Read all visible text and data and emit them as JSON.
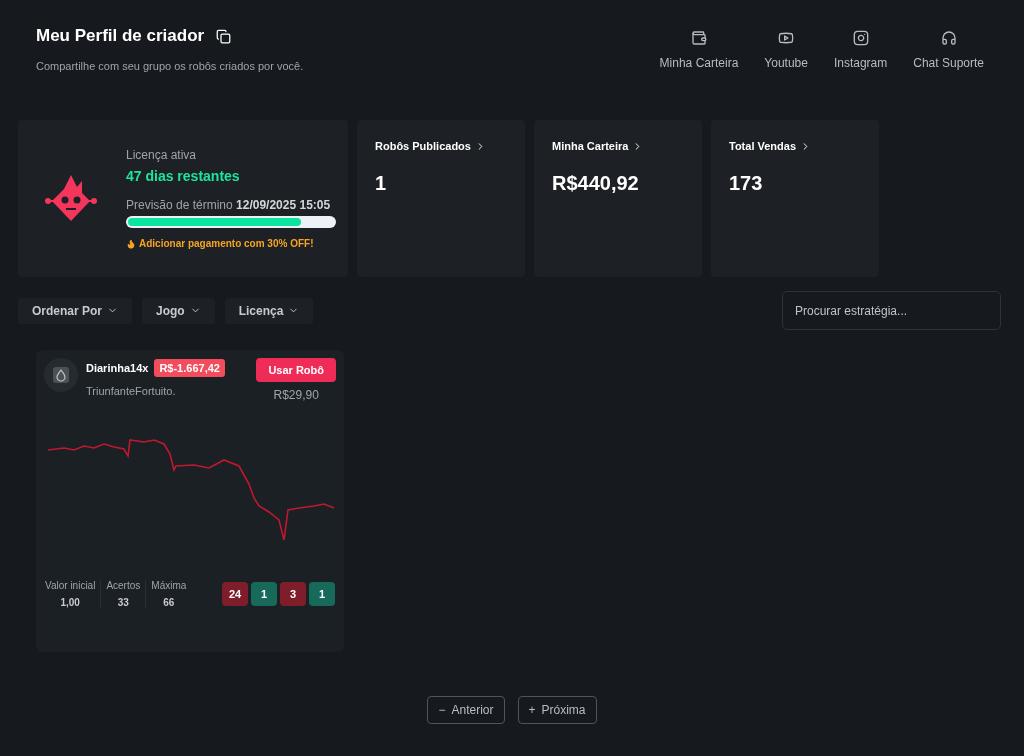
{
  "header": {
    "title": "Meu Perfil de criador",
    "subtitle": "Compartilhe com seu grupo os robôs criados por você."
  },
  "nav": [
    {
      "kind": "wallet",
      "label": "Minha Carteira"
    },
    {
      "kind": "youtube",
      "label": "Youtube"
    },
    {
      "kind": "instagram",
      "label": "Instagram"
    },
    {
      "kind": "support",
      "label": "Chat Suporte"
    }
  ],
  "license": {
    "label": "Licença ativa",
    "days": "47 dias restantes",
    "forecast_label": "Previsão de término",
    "forecast_date": "12/09/2025 15:05",
    "level": 0.84,
    "promo": "Adicionar pagamento com 30% OFF!"
  },
  "stats": [
    {
      "label": "Robôs Publicados",
      "value": "1"
    },
    {
      "label": "Minha Carteira",
      "value": "R$440,92"
    },
    {
      "label": "Total Vendas",
      "value": "173"
    }
  ],
  "filters": [
    "Ordenar Por",
    "Jogo",
    "Licença"
  ],
  "search": {
    "placeholder": "Procurar estratégia..."
  },
  "robots": [
    {
      "name": "Diarinha14x",
      "balance": "R$-1.667,42",
      "author": "TriunfanteFortuito.",
      "action": "Usar Robô",
      "price": "R$29,90",
      "metrics": [
        {
          "label": "Valor inicial",
          "value": "1,00"
        },
        {
          "label": "Acertos",
          "value": "33"
        },
        {
          "label": "Máxima",
          "value": "66"
        }
      ],
      "results": [
        {
          "value": "24",
          "color": "#7f1d2a"
        },
        {
          "value": "1",
          "color": "#17695a"
        },
        {
          "value": "3",
          "color": "#7f1d2a"
        },
        {
          "value": "1",
          "color": "#17695a"
        }
      ]
    }
  ],
  "pagination": {
    "prev": "Anterior",
    "prev_symbol": "−",
    "next": "Próxima",
    "next_symbol": "+"
  }
}
